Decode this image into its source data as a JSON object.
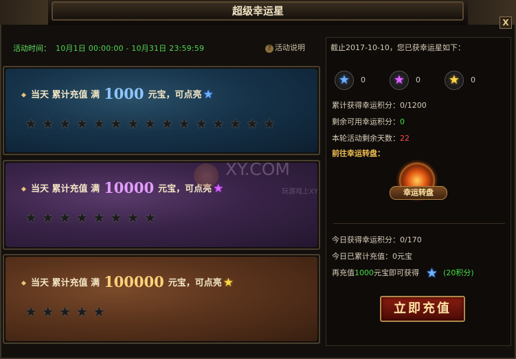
{
  "window": {
    "title": "超级幸运星",
    "close_label": "X"
  },
  "activity": {
    "time_label": "活动时间：",
    "time_value": "10月1日 00:00:00 - 10月31日 23:59:59",
    "help_label": "活动说明",
    "help_icon": "?"
  },
  "tiers": [
    {
      "prefix": "当天 累计充值 满",
      "amount": "1000",
      "suffix": "元宝，可点亮",
      "star_color": "blue",
      "star_count": 15
    },
    {
      "prefix": "当天 累计充值 满",
      "amount": "10000",
      "suffix": "元宝，可点亮",
      "star_color": "purple",
      "star_count": 8
    },
    {
      "prefix": "当天 累计充值 满",
      "amount": "100000",
      "suffix": "元宝，可点亮",
      "star_color": "gold",
      "star_count": 5
    }
  ],
  "summary": {
    "header": "截止2017-10-10，您已获幸运星如下：",
    "collected": [
      {
        "color": "blue",
        "count": "0"
      },
      {
        "color": "purple",
        "count": "0"
      },
      {
        "color": "gold",
        "count": "0"
      }
    ],
    "total_points_label": "累计获得幸运积分：",
    "total_points_value": "0/1200",
    "available_label": "剩余可用幸运积分：",
    "available_value": "0",
    "days_label": "本轮活动剩余天数：",
    "days_value": "22",
    "goto_label": "前往幸运转盘：",
    "wheel_label": "幸运转盘",
    "today_points_label": "今日获得幸运积分：",
    "today_points_value": "0/170",
    "today_charge_label": "今日已累计充值：",
    "today_charge_value": "0元宝",
    "next_prefix": "再充值",
    "next_amount": "1000",
    "next_suffix": "元宝即可获得",
    "next_reward": "(20积分)",
    "charge_button": "立即充值"
  },
  "watermark": {
    "text": "XY.COM",
    "sub": "玩游戏上XY"
  },
  "colors": {
    "blue_star": "#6fb0ff",
    "purple_star": "#dd66ff",
    "gold_star": "#ffd64a",
    "green_text": "#45e045",
    "red_text": "#ff4b4b"
  }
}
